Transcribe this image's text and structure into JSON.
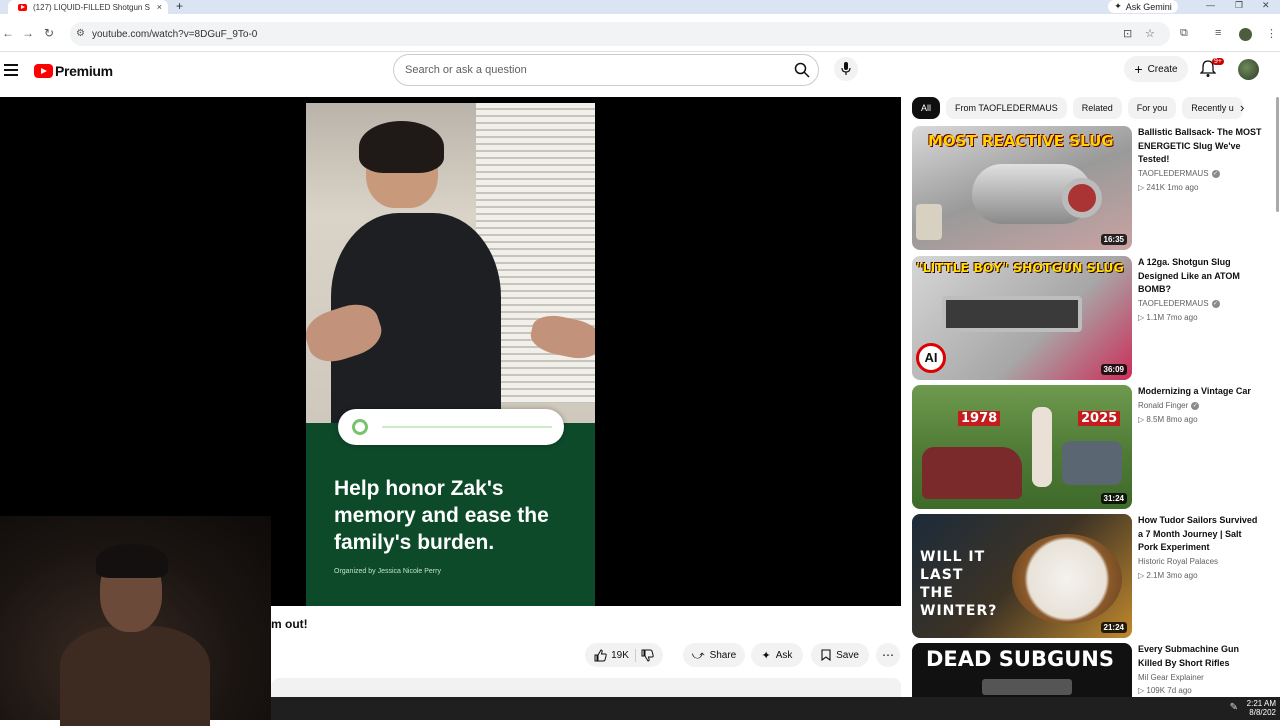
{
  "browser": {
    "tab_title": "(127) LIQUID-FILLED Shotgun S",
    "new_tab": "+",
    "tab_close": "×",
    "ask_gemini": "Ask Gemini",
    "url": "youtube.com/watch?v=8DGuF_9To-0"
  },
  "header": {
    "logo_text": "Premium",
    "search_placeholder": "Search or ask a question",
    "create_label": "Create",
    "notifications_badge": "9+"
  },
  "video": {
    "overlay_headline": "Help honor Zak's memory and ease the family's burden.",
    "overlay_organizer": "Organized by Jessica Nicole Perry",
    "title_fragment": "m out!",
    "like_count": "19K",
    "share_label": "Share",
    "ask_label": "Ask",
    "save_label": "Save"
  },
  "chips": [
    "All",
    "From TAOFLEDERMAUS",
    "Related",
    "For you",
    "Recently u"
  ],
  "recommendations": [
    {
      "title": "Ballistic Ballsack- The MOST ENERGETIC Slug We've Tested!",
      "channel": "TAOFLEDERMAUS",
      "verified": true,
      "meta": "▷ 241K  1mo ago",
      "duration": "16:35",
      "thumb_text": "MOST REACTIVE SLUG"
    },
    {
      "title": "A 12ga. Shotgun Slug Designed Like an ATOM BOMB?",
      "channel": "TAOFLEDERMAUS",
      "verified": true,
      "meta": "▷ 1.1M  7mo ago",
      "duration": "36:09",
      "thumb_text": "\"LITTLE BOY\" SHOTGUN SLUG",
      "thumb_badge": "AI"
    },
    {
      "title": "Modernizing a Vintage Car",
      "channel": "Ronald Finger",
      "verified": true,
      "meta": "▷ 8.5M  8mo ago",
      "duration": "31:24",
      "thumb_text_left": "1978",
      "thumb_text_right": "2025"
    },
    {
      "title": "How Tudor Sailors Survived a 7 Month Journey | Salt Pork Experiment",
      "channel": "Historic Royal Palaces",
      "verified": false,
      "meta": "▷ 2.1M  3mo ago",
      "duration": "21:24",
      "thumb_text": "WILL IT LAST THE WINTER?"
    },
    {
      "title": "Every Submachine Gun Killed By Short Rifles",
      "channel": "Mil Gear Explainer",
      "verified": false,
      "meta": "▷ 109K  7d ago",
      "duration": "",
      "thumb_text": "DEAD SUBGUNS"
    }
  ],
  "taskbar": {
    "time": "2:21 AM",
    "date": "8/8/202"
  },
  "colors": {
    "youtube_red": "#ff0000",
    "gofundme_green": "#0d4a2a",
    "thumb_border_red": "#cc1a1a"
  }
}
